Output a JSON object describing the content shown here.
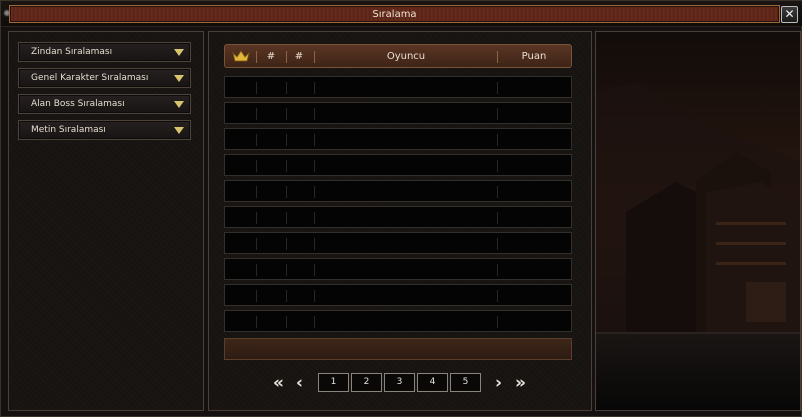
{
  "window": {
    "title": "Sıralama",
    "close_symbol": "✕"
  },
  "left_menu": {
    "items": [
      {
        "label": "Zindan Sıralaması"
      },
      {
        "label": "Genel Karakter Sıralaması"
      },
      {
        "label": "Alan Boss Sıralaması"
      },
      {
        "label": "Metin Sıralaması"
      }
    ]
  },
  "table": {
    "headers": {
      "rank_a": "#",
      "rank_b": "#",
      "player": "Oyuncu",
      "score": "Puan"
    },
    "row_count": 10
  },
  "pager": {
    "first": "«",
    "prev": "‹",
    "next": "›",
    "last": "»",
    "pages": [
      "1",
      "2",
      "3",
      "4",
      "5"
    ]
  },
  "colors": {
    "title_strip": "#5a2519",
    "header_bar": "#4a2c1d",
    "accent_gold": "#d8c36e",
    "crown_gold": "#e0b53a"
  }
}
